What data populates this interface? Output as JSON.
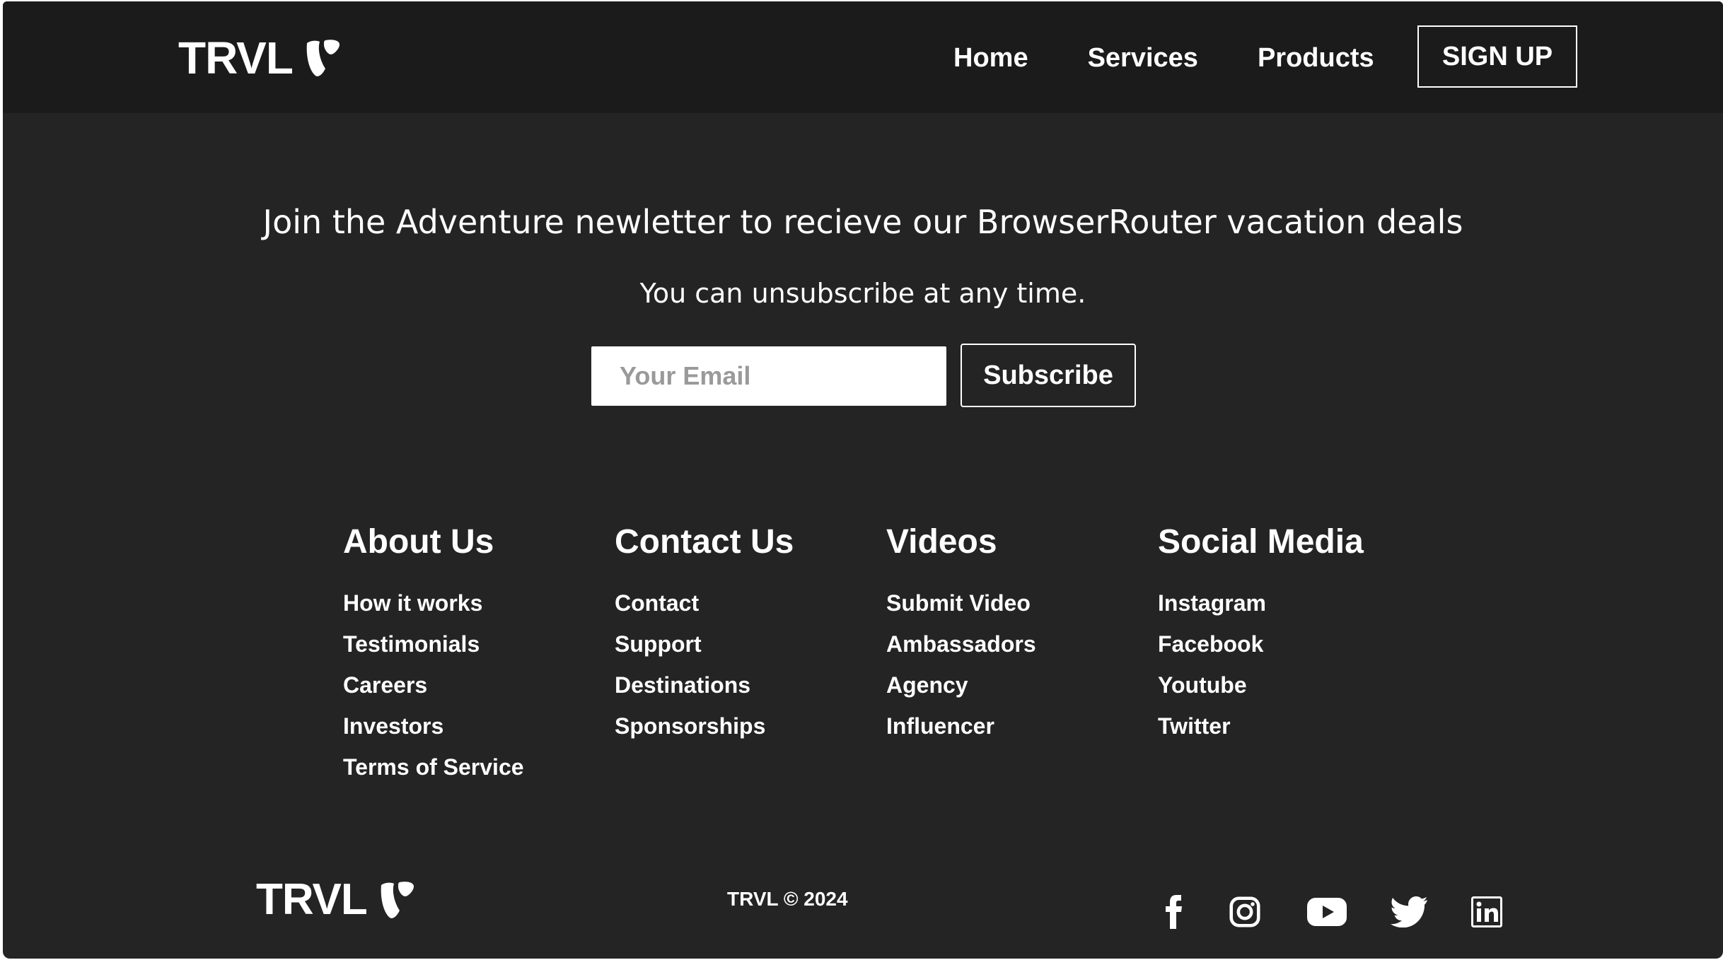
{
  "navbar": {
    "brand": "TRVL",
    "links": [
      {
        "label": "Home"
      },
      {
        "label": "Services"
      },
      {
        "label": "Products"
      }
    ],
    "signup_label": "SIGN UP"
  },
  "newsletter": {
    "heading": "Join the Adventure newletter to recieve our BrowserRouter vacation deals",
    "subheading": "You can unsubscribe at any time.",
    "email_placeholder": "Your Email",
    "subscribe_label": "Subscribe"
  },
  "footer": {
    "columns": [
      {
        "title": "About Us",
        "links": [
          "How it works",
          "Testimonials",
          "Careers",
          "Investors",
          "Terms of Service"
        ]
      },
      {
        "title": "Contact Us",
        "links": [
          "Contact",
          "Support",
          "Destinations",
          "Sponsorships"
        ]
      },
      {
        "title": "Videos",
        "links": [
          "Submit Video",
          "Ambassadors",
          "Agency",
          "Influencer"
        ]
      },
      {
        "title": "Social Media",
        "links": [
          "Instagram",
          "Facebook",
          "Youtube",
          "Twitter"
        ]
      }
    ],
    "brand": "TRVL",
    "copyright": "TRVL © 2024",
    "social_icons": [
      "facebook-icon",
      "instagram-icon",
      "youtube-icon",
      "twitter-icon",
      "linkedin-icon"
    ]
  },
  "colors": {
    "page_background": "#242424",
    "navbar_background": "#1b1b1b",
    "text": "#ffffff"
  }
}
